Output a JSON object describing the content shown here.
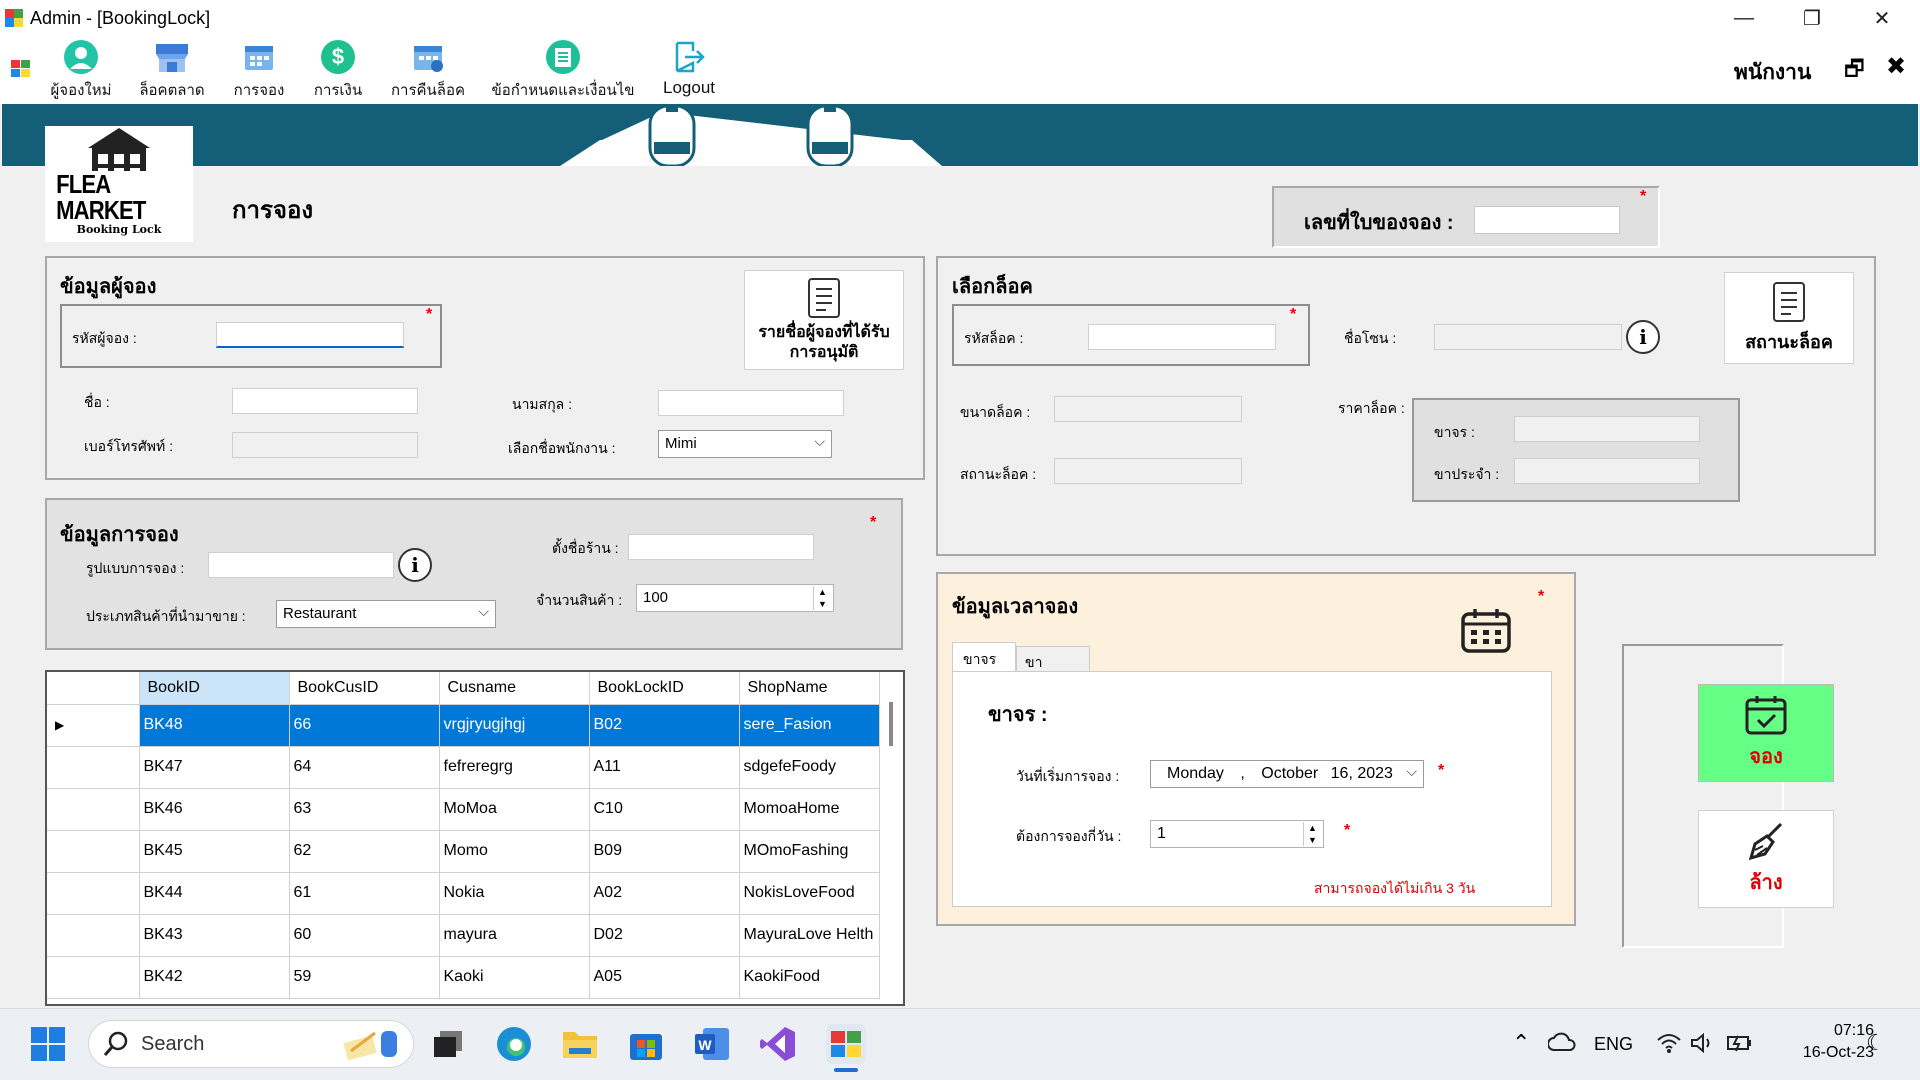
{
  "window": {
    "title": "Admin - [BookingLock]",
    "minimize": "—",
    "restore": "❐",
    "close": "✕"
  },
  "menu": {
    "items": [
      {
        "label": "ผู้จองใหม่",
        "icon": "user-icon"
      },
      {
        "label": "ล็อคตลาด",
        "icon": "market-stall-icon"
      },
      {
        "label": "การจอง",
        "icon": "calendar-booking-icon"
      },
      {
        "label": "การเงิน",
        "icon": "dollar-icon"
      },
      {
        "label": "การคืนล็อค",
        "icon": "calendar-return-icon"
      },
      {
        "label": "ข้อกำหนดและเงื่อนไข",
        "icon": "terms-icon"
      },
      {
        "label": "Logout",
        "icon": "logout-icon"
      }
    ],
    "staff_label": "พนักงาน",
    "mdi_restore": "🗗",
    "mdi_close": "✖"
  },
  "logo": {
    "name": "FLEA MARKET",
    "sub": "Booking Lock"
  },
  "page_title": "การจอง",
  "booking_no": {
    "label": "เลขที่ใบของจอง :",
    "value": ""
  },
  "customer": {
    "title": "ข้อมูลผู้จอง",
    "id_label": "รหัสผู้จอง :",
    "id_value": "",
    "approved_button": "รายชื่อผู้จองที่ได้รับการอนุมัติ",
    "name_label": "ชื่อ :",
    "name_value": "",
    "surname_label": "นามสกุล :",
    "surname_value": "",
    "phone_label": "เบอร์โทรศัพท์ :",
    "phone_value": "",
    "staff_label": "เลือกชื่อพนักงาน :",
    "staff_value": "Mimi"
  },
  "booking_info": {
    "title": "ข้อมูลการจอง",
    "type_label": "รูปแบบการจอง :",
    "type_value": "",
    "shop_label": "ตั้งชื่อร้าน :",
    "shop_value": "",
    "category_label": "ประเภทสินค้าที่นำมาขาย :",
    "category_value": "Restaurant",
    "qty_label": "จำนวนสินค้า :",
    "qty_value": "100"
  },
  "lock": {
    "title": "เลือกล็อค",
    "id_label": "รหัสล็อค :",
    "zone_label": "ชื่อโซน :",
    "status_button": "สถานะล็อค",
    "size_label": "ขนาดล็อค :",
    "price_label": "ราคาล็อค :",
    "walkin_label": "ขาจร :",
    "regular_label": "ขาประจำ :",
    "state_label": "สถานะล็อค :"
  },
  "time": {
    "title": "ข้อมูลเวลาจอง",
    "tabs": [
      "ขาจร",
      "ขาประจำ"
    ],
    "section": "ขาจร :",
    "start_label": "วันที่เริ่มการจอง :",
    "date_day": "Monday",
    "date_sep": ",",
    "date_month": "October",
    "date_rest": "16, 2023",
    "days_label": "ต้องการจองกี่วัน :",
    "days_value": "1",
    "note": "สามารถจองได้ไม่เกิน 3 วัน"
  },
  "actions": {
    "book": "จอง",
    "clear": "ล้าง"
  },
  "grid": {
    "columns": [
      "BookID",
      "BookCusID",
      "Cusname",
      "BookLockID",
      "ShopName"
    ],
    "rows": [
      [
        "BK48",
        "66",
        "vrgjryugjhgj",
        "B02",
        "sere_Fasion"
      ],
      [
        "BK47",
        "64",
        "fefreregrg",
        "A11",
        "sdgefeFoody"
      ],
      [
        "BK46",
        "63",
        "MoMoa",
        "C10",
        "MomoaHome"
      ],
      [
        "BK45",
        "62",
        "Momo",
        "B09",
        "MOmoFashing"
      ],
      [
        "BK44",
        "61",
        "Nokia",
        "A02",
        "NokisLoveFood"
      ],
      [
        "BK43",
        "60",
        "mayura",
        "D02",
        "MayuraLove Helth"
      ],
      [
        "BK42",
        "59",
        "Kaoki",
        "A05",
        "KaokiFood"
      ]
    ]
  },
  "taskbar": {
    "search": "Search",
    "lang": "ENG",
    "time": "07:16",
    "date": "16-Oct-23"
  }
}
